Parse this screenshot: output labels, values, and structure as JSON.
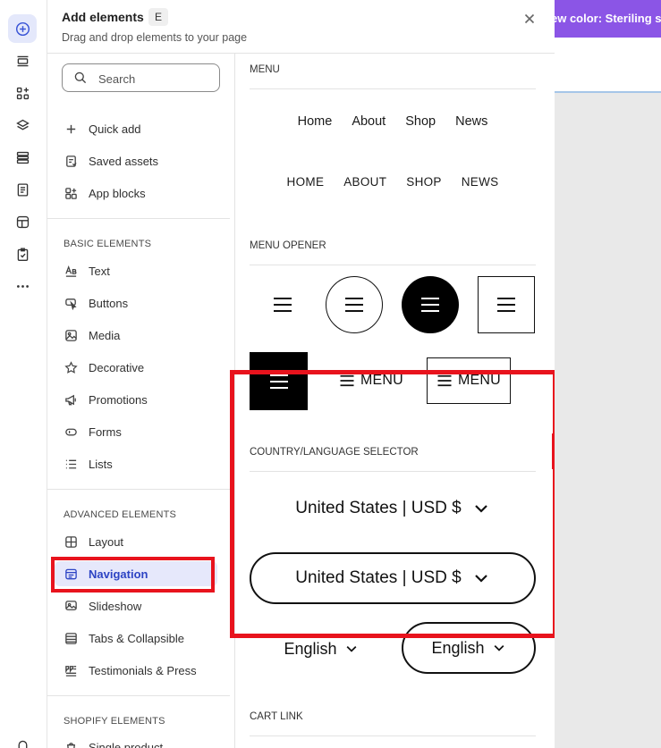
{
  "rail": {
    "icons": [
      "add-icon",
      "header-section-icon",
      "apps-icon",
      "layers-icon",
      "sections-icon",
      "pages-icon",
      "theme-icon",
      "checklist-icon",
      "more-icon",
      "bell-icon"
    ]
  },
  "panel": {
    "title": "Add elements",
    "shortcut": "E",
    "subtitle": "Drag and drop elements to your page"
  },
  "search": {
    "placeholder": "Search"
  },
  "quick": [
    {
      "label": "Quick add",
      "icon": "plus-icon"
    },
    {
      "label": "Saved assets",
      "icon": "saved-assets-icon"
    },
    {
      "label": "App blocks",
      "icon": "app-blocks-icon"
    }
  ],
  "basic": {
    "heading": "BASIC ELEMENTS",
    "items": [
      {
        "label": "Text",
        "icon": "text-icon"
      },
      {
        "label": "Buttons",
        "icon": "button-cursor-icon"
      },
      {
        "label": "Media",
        "icon": "image-icon"
      },
      {
        "label": "Decorative",
        "icon": "star-icon"
      },
      {
        "label": "Promotions",
        "icon": "megaphone-icon"
      },
      {
        "label": "Forms",
        "icon": "form-icon"
      },
      {
        "label": "Lists",
        "icon": "list-icon"
      }
    ]
  },
  "advanced": {
    "heading": "ADVANCED ELEMENTS",
    "items": [
      {
        "label": "Layout",
        "icon": "layout-grid-icon"
      },
      {
        "label": "Navigation",
        "icon": "navigation-icon",
        "selected": true
      },
      {
        "label": "Slideshow",
        "icon": "slideshow-icon"
      },
      {
        "label": "Tabs & Collapsible",
        "icon": "tabs-icon"
      },
      {
        "label": "Testimonials & Press",
        "icon": "testimonials-icon"
      }
    ]
  },
  "shopify": {
    "heading": "SHOPIFY ELEMENTS",
    "items": [
      {
        "label": "Single product",
        "icon": "product-icon"
      }
    ]
  },
  "preview": {
    "menu_heading": "MENU",
    "menu_items": [
      "Home",
      "About",
      "Shop",
      "News"
    ],
    "menu_items_caps": [
      "HOME",
      "ABOUT",
      "SHOP",
      "NEWS"
    ],
    "opener_heading": "MENU OPENER",
    "opener_label": "MENU",
    "country_heading": "COUNTRY/LANGUAGE SELECTOR",
    "country_value": "United States | USD $",
    "language_value": "English",
    "cart_heading": "CART LINK"
  },
  "site": {
    "banner_text": "ew color: Steriling s"
  },
  "colors": {
    "accent": "#3a55d6",
    "highlight": "#e8131d",
    "banner": "#8b55e6",
    "selected_bg": "#e6e8fb"
  }
}
